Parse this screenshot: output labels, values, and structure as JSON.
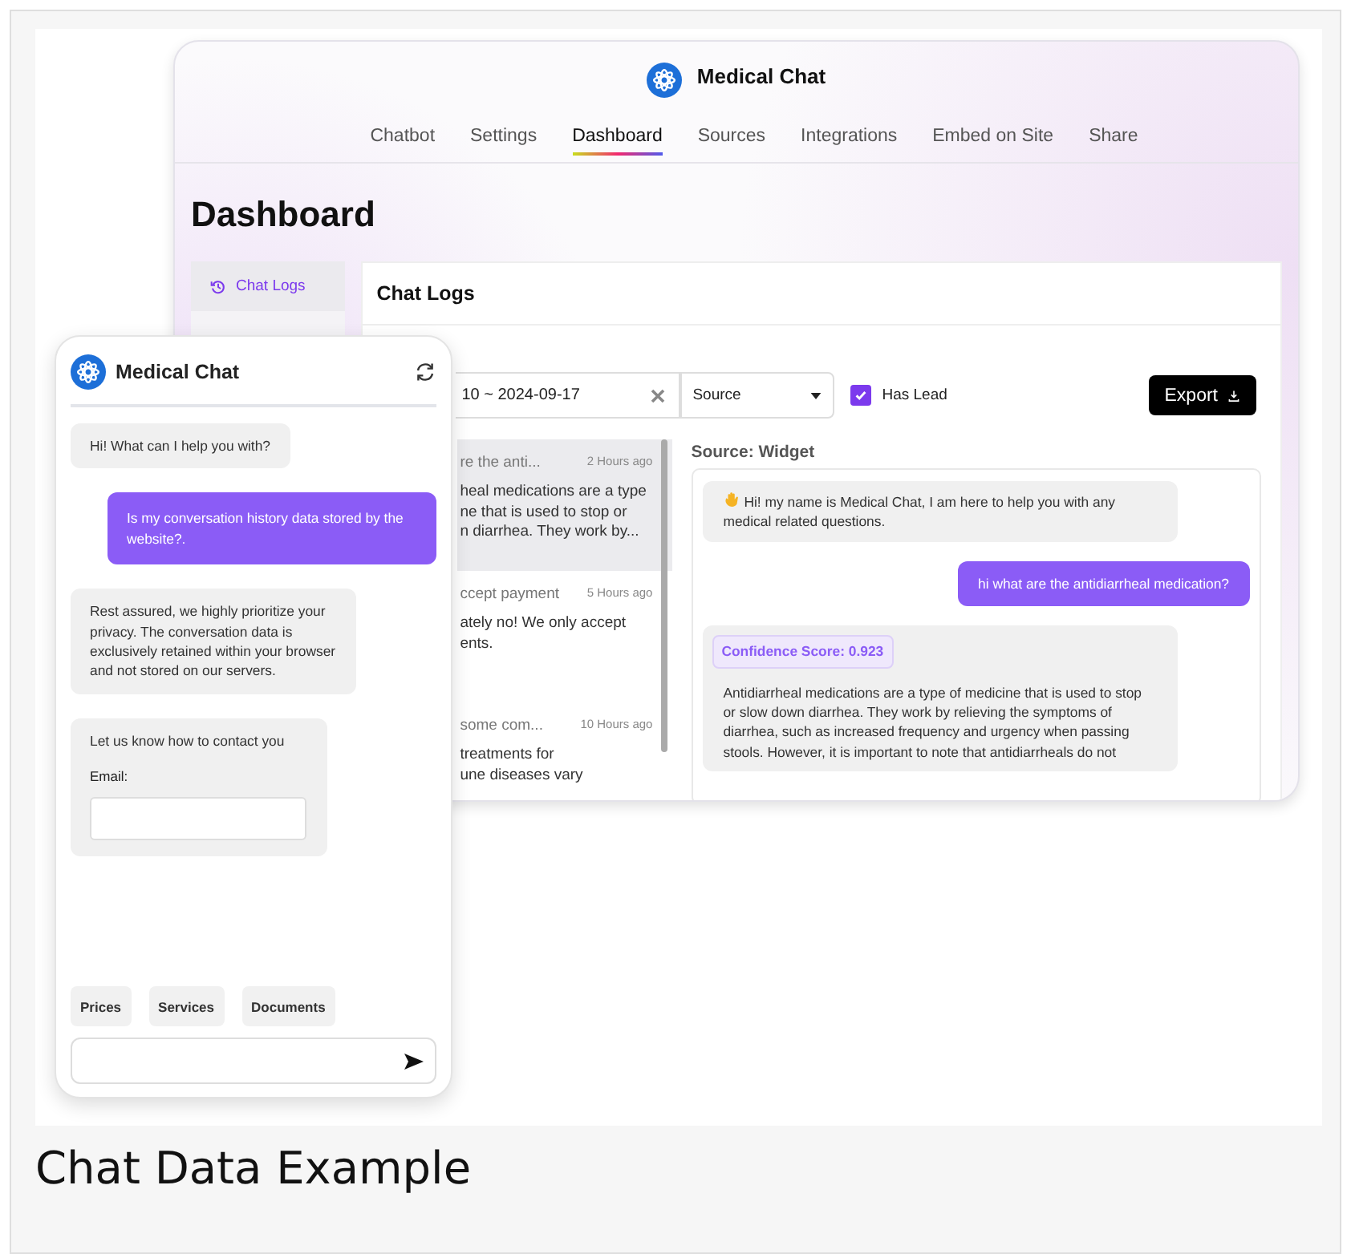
{
  "dashboard": {
    "app_title": "Medical Chat",
    "tabs": [
      {
        "label": "Chatbot",
        "selected": false
      },
      {
        "label": "Settings",
        "selected": false
      },
      {
        "label": "Dashboard",
        "selected": true
      },
      {
        "label": "Sources",
        "selected": false
      },
      {
        "label": "Integrations",
        "selected": false
      },
      {
        "label": "Embed on Site",
        "selected": false
      },
      {
        "label": "Share",
        "selected": false
      }
    ],
    "page_title": "Dashboard",
    "sidebar": {
      "items": [
        {
          "label": "Chat Logs",
          "selected": true
        }
      ]
    },
    "panel": {
      "title": "Chat Logs",
      "date_range": "10 ~ 2024-09-17",
      "source_select": "Source",
      "has_lead": {
        "label": "Has Lead",
        "checked": true
      },
      "export_button": "Export",
      "conversations": [
        {
          "title": "re the anti...",
          "time": "2 Hours ago",
          "lines": [
            "heal medications are a type",
            "ne that is used to stop or",
            "n diarrhea. They work by..."
          ],
          "selected": true
        },
        {
          "title": "ccept payment",
          "time": "5 Hours ago",
          "lines": [
            "ately no! We only accept",
            "ents."
          ],
          "selected": false
        },
        {
          "title": "some com...",
          "time": "10 Hours ago",
          "lines": [
            "treatments for",
            "une diseases vary"
          ],
          "selected": false
        }
      ],
      "source_label": "Source: Widget",
      "messages": [
        {
          "kind": "bot",
          "wave": true,
          "text": "Hi! my name is Medical Chat, I am here to help you with any medical related questions."
        },
        {
          "kind": "user",
          "text": "hi what are the antidiarrheal medication?"
        },
        {
          "kind": "bot",
          "badge": "Confidence Score: 0.923",
          "text": "Antidiarrheal medications are a type of medicine that is used to stop or slow down diarrhea. They work by relieving the symptoms of diarrhea, such as increased frequency and urgency when passing stools. However, it is important to note that antidiarrheals do not"
        }
      ]
    }
  },
  "widget": {
    "title": "Medical Chat",
    "messages": [
      {
        "kind": "bot",
        "text": "Hi! What can I help you with?"
      },
      {
        "kind": "user",
        "text": "Is my conversation history data stored by the website?."
      },
      {
        "kind": "bot",
        "text": "Rest assured, we highly prioritize your privacy. The conversation data is exclusively retained within your browser and not stored on our servers."
      },
      {
        "kind": "form",
        "text": "Let us know how to contact you",
        "field_label": "Email:"
      }
    ],
    "quick_replies": [
      "Prices",
      "Services",
      "Documents"
    ]
  },
  "caption": "Chat Data Example"
}
